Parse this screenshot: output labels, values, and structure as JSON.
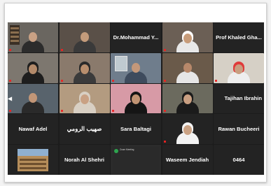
{
  "tiles": [
    {
      "type": "video",
      "label": "",
      "skin": "#c9a184",
      "cloth": "#2c2c2c",
      "bg": "#6a6660"
    },
    {
      "type": "video",
      "label": "",
      "skin": "#c39b7b",
      "cloth": "#3a3a3a",
      "bg": "#5a5048"
    },
    {
      "type": "name",
      "name": "Dr.Mohammad Y..."
    },
    {
      "type": "video",
      "label": "",
      "skin": "#c79c7a",
      "cloth": "#e8e8e8",
      "bg": "#6b5f55",
      "headwear": "#ffffff"
    },
    {
      "type": "name",
      "name": "Prof Khaled Gha..."
    },
    {
      "type": "video",
      "label": "",
      "skin": "#b38a6a",
      "cloth": "#1e1e1e",
      "bg": "#7d776f",
      "headwear": "#1e1e1e"
    },
    {
      "type": "video",
      "label": "",
      "skin": "#b88e6d",
      "cloth": "#3b3b3b",
      "bg": "#8a7a6c",
      "headwear": "#2a2a2a"
    },
    {
      "type": "video",
      "label": "",
      "skin": "#c4987a",
      "cloth": "#3e4b5d",
      "bg": "#6f7d8c"
    },
    {
      "type": "video",
      "label": "",
      "skin": "#b7886a",
      "cloth": "#e6e6e6",
      "bg": "#6a5a4a"
    },
    {
      "type": "video",
      "label": "",
      "skin": "#c89e80",
      "cloth": "#eeeeee",
      "bg": "#d6d0c6",
      "headwear": "#e03a3a"
    },
    {
      "type": "video",
      "label": "",
      "skin": "#c29677",
      "cloth": "#2a2a2a",
      "bg": "#58636c"
    },
    {
      "type": "video",
      "label": "",
      "skin": "#c9a184",
      "cloth": "#d8cfc3",
      "bg": "#b39b80",
      "headwear": "#d8cfc3"
    },
    {
      "type": "video",
      "label": "",
      "skin": "#c09373",
      "cloth": "#151515",
      "bg": "#d79aa6",
      "headwear": "#151515"
    },
    {
      "type": "video",
      "label": "",
      "skin": "#c99f82",
      "cloth": "#1b1b1b",
      "bg": "#6b6a5e",
      "headwear": "#1b1b1b"
    },
    {
      "type": "name",
      "name": "Tajihan Ibrahin",
      "align": "right"
    },
    {
      "type": "name",
      "name": "Nawaf Adel"
    },
    {
      "type": "name",
      "name": "صهيب الرومي",
      "rtl": true
    },
    {
      "type": "name",
      "name": "Sara Baltagi"
    },
    {
      "type": "video",
      "label": "",
      "skin": "#caa284",
      "cloth": "#f2f2f2",
      "bg": "#232323",
      "headwear": "#f2f2f2"
    },
    {
      "type": "name",
      "name": "Rawan Bucheeri"
    },
    {
      "type": "building"
    },
    {
      "type": "name",
      "name": "Norah Al Shehri"
    },
    {
      "type": "shared",
      "lines": [
        "Zoom Meeting",
        "",
        "",
        "",
        ""
      ]
    },
    {
      "type": "name",
      "name": "Waseem Jendiah"
    },
    {
      "type": "name",
      "name": "0464"
    }
  ],
  "icons": {
    "active_speaker": "mic-icon",
    "share": "share-icon",
    "nav": "arrow-left-icon"
  }
}
